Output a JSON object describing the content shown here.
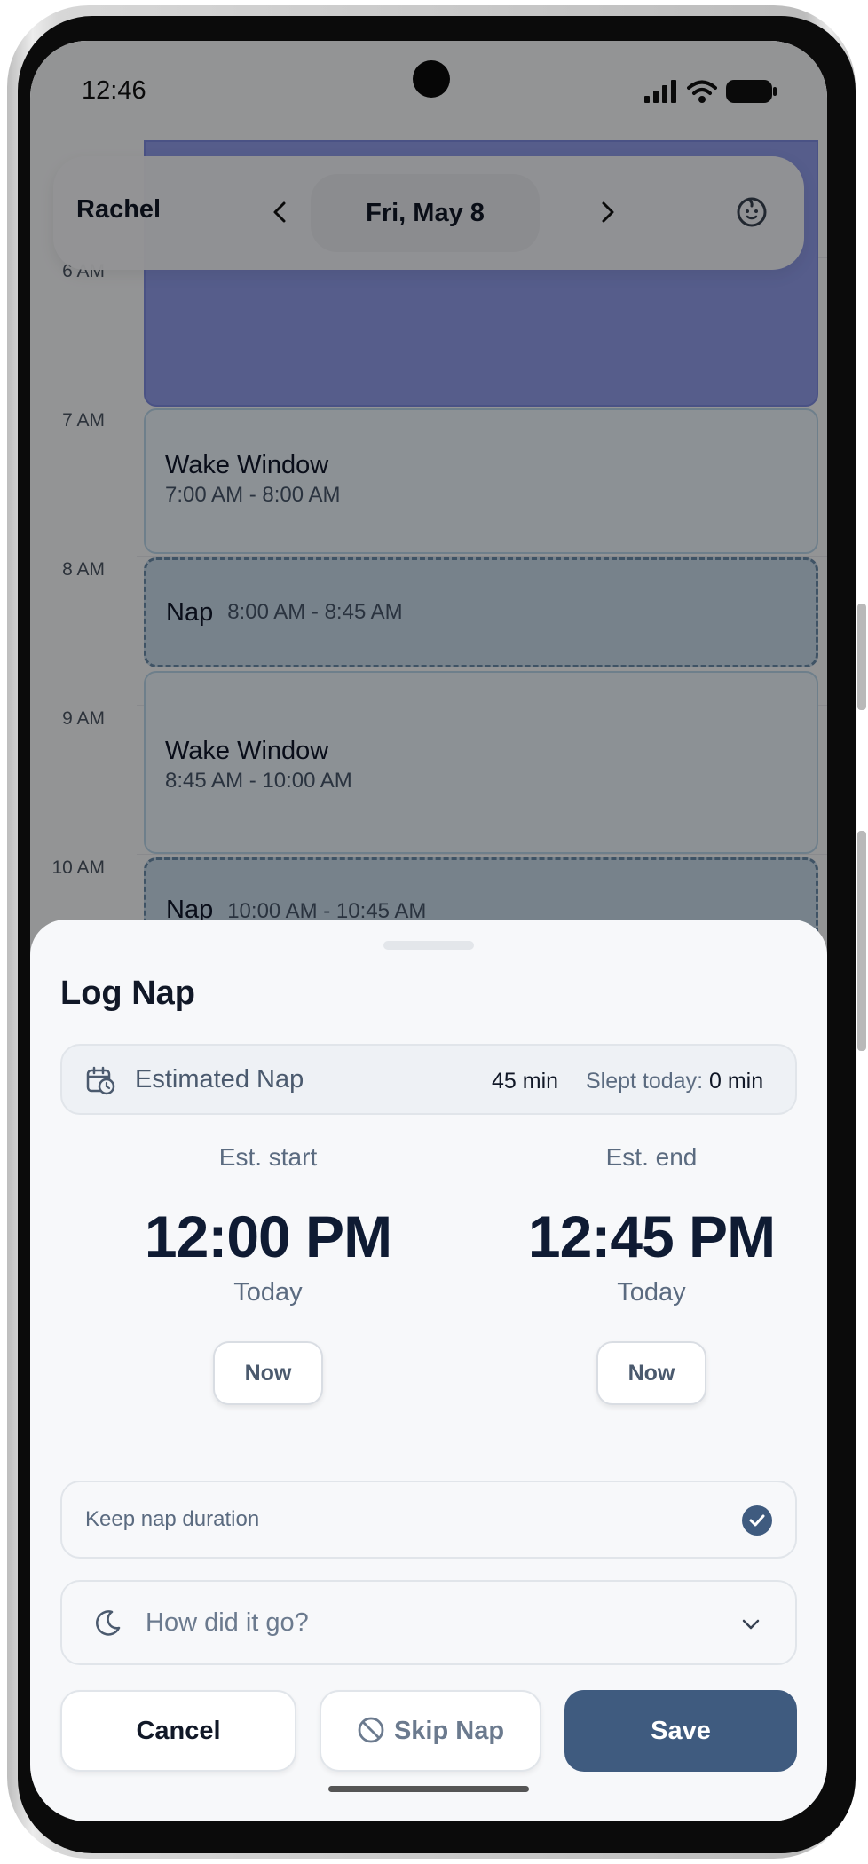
{
  "status_bar": {
    "time": "12:46"
  },
  "header": {
    "child_name": "Rachel",
    "date": "Fri, May 8",
    "prev_icon": "chevron-left-icon",
    "next_icon": "chevron-right-icon",
    "baby_icon": "baby-face-icon"
  },
  "timeline": {
    "hours": [
      "6 AM",
      "7 AM",
      "8 AM",
      "9 AM",
      "10 AM"
    ],
    "blocks": [
      {
        "type": "wake",
        "title": "Wake Window",
        "time": "7:00 AM - 8:00 AM"
      },
      {
        "type": "nap",
        "title": "Nap",
        "time": "8:00 AM - 8:45 AM"
      },
      {
        "type": "wake",
        "title": "Wake Window",
        "time": "8:45 AM - 10:00 AM"
      },
      {
        "type": "nap",
        "title": "Nap",
        "time": "10:00 AM - 10:45 AM"
      }
    ],
    "colors": {
      "sleep": "#8f9be8",
      "wake": "#e9f2f8",
      "nap": "#c6d9e8"
    }
  },
  "sheet": {
    "title": "Log Nap",
    "estimate": {
      "label": "Estimated Nap",
      "duration": "45 min",
      "slept_label": "Slept today:",
      "slept_value": "0 min",
      "icon": "calendar-clock-icon"
    },
    "start": {
      "label": "Est. start",
      "time": "12:00 PM",
      "day": "Today",
      "now_label": "Now"
    },
    "end": {
      "label": "Est. end",
      "time": "12:45 PM",
      "day": "Today",
      "now_label": "Now"
    },
    "keep_duration": {
      "label": "Keep nap duration",
      "checked": true
    },
    "how": {
      "placeholder": "How did it go?",
      "icon": "moon-icon"
    },
    "buttons": {
      "cancel": "Cancel",
      "skip": "Skip Nap",
      "save": "Save"
    },
    "accent_color": "#3f5b7f"
  }
}
